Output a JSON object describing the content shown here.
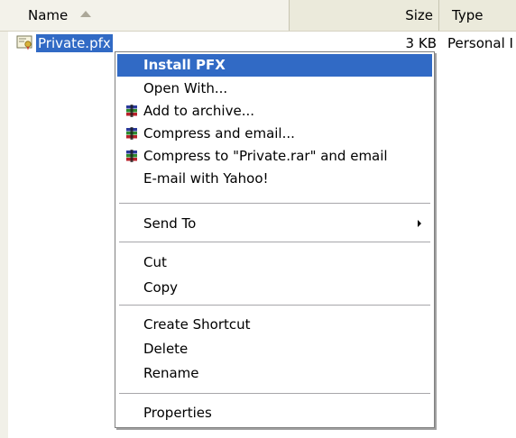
{
  "columns": {
    "name": "Name",
    "size": "Size",
    "type": "Type"
  },
  "file": {
    "name": "Private.pfx",
    "size": "3 KB",
    "type": "Personal I"
  },
  "context_menu": {
    "items": [
      {
        "label": "Install PFX",
        "highlighted": true
      },
      {
        "label": "Open With..."
      },
      {
        "label": "Add to archive...",
        "icon": "winrar-icon"
      },
      {
        "label": "Compress and email...",
        "icon": "winrar-icon"
      },
      {
        "label": "Compress to \"Private.rar\" and email",
        "icon": "winrar-icon"
      },
      {
        "label": "E-mail with Yahoo!"
      },
      {
        "label": "Send To",
        "submenu": true
      },
      {
        "label": "Cut"
      },
      {
        "label": "Copy"
      },
      {
        "label": "Create Shortcut"
      },
      {
        "label": "Delete"
      },
      {
        "label": "Rename"
      },
      {
        "label": "Properties"
      }
    ]
  },
  "colors": {
    "highlight": "#316ac5",
    "header_bg": "#ebeadb"
  }
}
